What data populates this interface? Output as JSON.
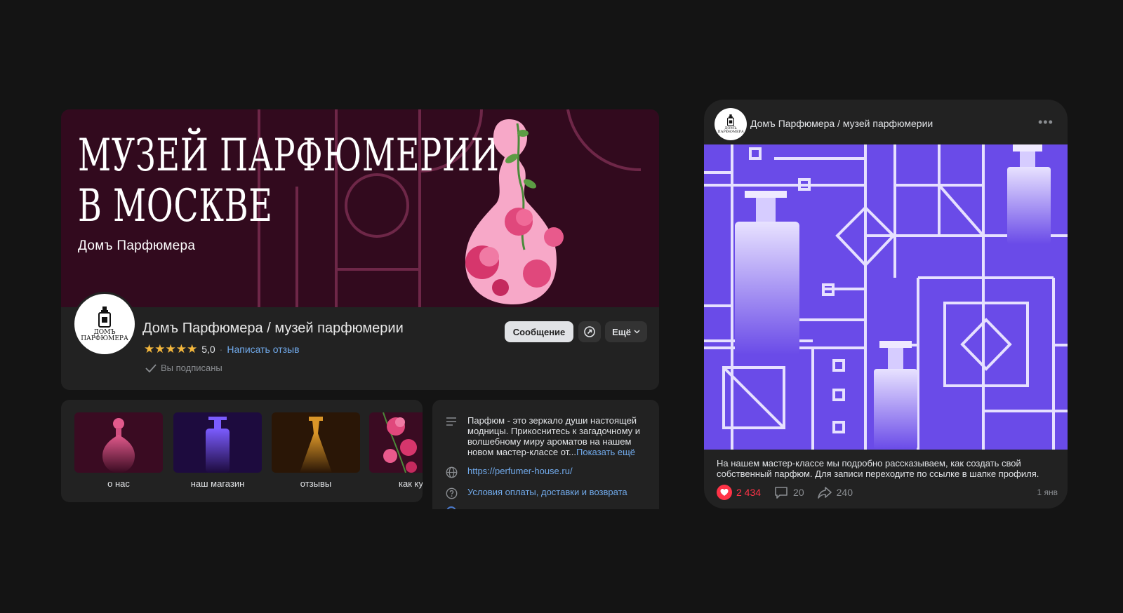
{
  "profile": {
    "cover_title_line1": "МУЗЕЙ ПАРФЮМЕРИИ",
    "cover_title_line2": "В МОСКВЕ",
    "cover_brand": "Домъ Парфюмера",
    "avatar_logo_line1": "ДОМЪ",
    "avatar_logo_line2": "ПАРФЮМЕРА",
    "name": "Домъ Парфюмера / музей парфюмерии",
    "rating_stars": "★★★★★",
    "rating_value": "5,0",
    "rating_separator": "·",
    "write_review": "Написать отзыв",
    "subscribed": "Вы подписаны",
    "message_button": "Сообщение",
    "more_button": "Ещё",
    "colors": {
      "cover_bg": "#320a1e",
      "card_bg": "#222222",
      "link": "#71aaeb",
      "star": "#f5b83d"
    }
  },
  "highlights": [
    {
      "label": "о нас"
    },
    {
      "label": "наш магазин"
    },
    {
      "label": "отзывы"
    },
    {
      "label": "как куп"
    }
  ],
  "info": {
    "description": "Парфюм - это зеркало души настоящей модницы. Прикоснитесь к загадочному и волшебному миру ароматов на нашем новом мастер-классе от...",
    "show_more": "Показать ещё",
    "website": "https://perfumer-house.ru/",
    "terms": "Условия оплаты, доставки и возврата"
  },
  "post": {
    "author": "Домъ Парфюмера / музей парфюмерии",
    "avatar_logo_line1": "ДОМЪ",
    "avatar_logo_line2": "ПАРФЮМЕРА",
    "menu": "•••",
    "text": "На нашем мастер-классе мы подробно рассказываем, как создать свой собственный парфюм. Для записи переходите по ссылке в шапке профиля.",
    "likes": "2 434",
    "comments": "20",
    "shares": "240",
    "date": "1 янв",
    "colors": {
      "image_bg": "#6a4be8",
      "like": "#ff3347"
    }
  }
}
